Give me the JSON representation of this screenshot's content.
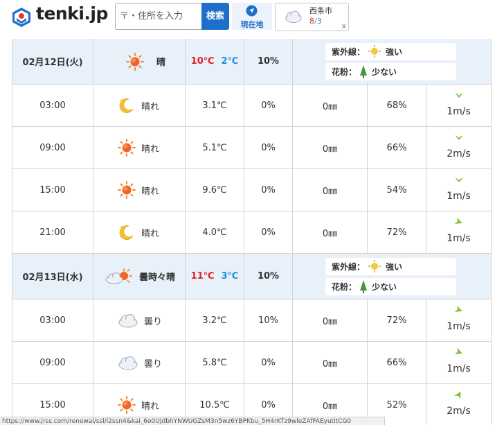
{
  "header": {
    "logo_text": "tenki.jp",
    "search": {
      "placeholder": "〒・住所を入力",
      "button_label": "検索"
    },
    "current_location_label": "現在地",
    "recent": {
      "city": "西条市",
      "high": "8",
      "sep": "/",
      "low": "3",
      "close": "x",
      "icon": "cloudy-icon"
    }
  },
  "days": [
    {
      "date": "02月12日(火)",
      "weather": "晴",
      "icon": "sunny-icon",
      "high": "10℃",
      "low": "2℃",
      "precip": "10%",
      "uv_label": "紫外線：",
      "uv_value": "強い",
      "pollen_label": "花粉：",
      "pollen_value": "少ない",
      "hours": [
        {
          "time": "03:00",
          "weather": "晴れ",
          "icon": "moon-icon",
          "temp": "3.1℃",
          "precip": "0%",
          "rain": "0㎜",
          "humidity": "68%",
          "wind": "1m/s",
          "wind_dir": "down"
        },
        {
          "time": "09:00",
          "weather": "晴れ",
          "icon": "sunny-icon",
          "temp": "5.1℃",
          "precip": "0%",
          "rain": "0㎜",
          "humidity": "66%",
          "wind": "2m/s",
          "wind_dir": "down"
        },
        {
          "time": "15:00",
          "weather": "晴れ",
          "icon": "sunny-icon",
          "temp": "9.6℃",
          "precip": "0%",
          "rain": "0㎜",
          "humidity": "54%",
          "wind": "1m/s",
          "wind_dir": "down"
        },
        {
          "time": "21:00",
          "weather": "晴れ",
          "icon": "moon-icon",
          "temp": "4.0℃",
          "precip": "0%",
          "rain": "0㎜",
          "humidity": "72%",
          "wind": "1m/s",
          "wind_dir": "right"
        }
      ]
    },
    {
      "date": "02月13日(水)",
      "weather": "曇時々晴",
      "icon": "cloudy-sunny-icon",
      "high": "11℃",
      "low": "3℃",
      "precip": "10%",
      "uv_label": "紫外線：",
      "uv_value": "強い",
      "pollen_label": "花粉：",
      "pollen_value": "少ない",
      "hours": [
        {
          "time": "03:00",
          "weather": "曇り",
          "icon": "cloudy-icon",
          "temp": "3.2℃",
          "precip": "10%",
          "rain": "0㎜",
          "humidity": "72%",
          "wind": "1m/s",
          "wind_dir": "right"
        },
        {
          "time": "09:00",
          "weather": "曇り",
          "icon": "cloudy-icon",
          "temp": "5.8℃",
          "precip": "0%",
          "rain": "0㎜",
          "humidity": "66%",
          "wind": "1m/s",
          "wind_dir": "right"
        },
        {
          "time": "15:00",
          "weather": "晴れ",
          "icon": "sunny-icon",
          "temp": "10.5℃",
          "precip": "0%",
          "rain": "0㎜",
          "humidity": "52%",
          "wind": "2m/s",
          "wind_dir": "up"
        }
      ]
    }
  ],
  "status_bar": "https://www.jrss.com/renewal/ssl/i2ssn4&kai_6o0UJdbhYNWUGZsM3n5wz6YBPKbu_5H4rKTz9wleZAfFAEyutitCG0"
}
